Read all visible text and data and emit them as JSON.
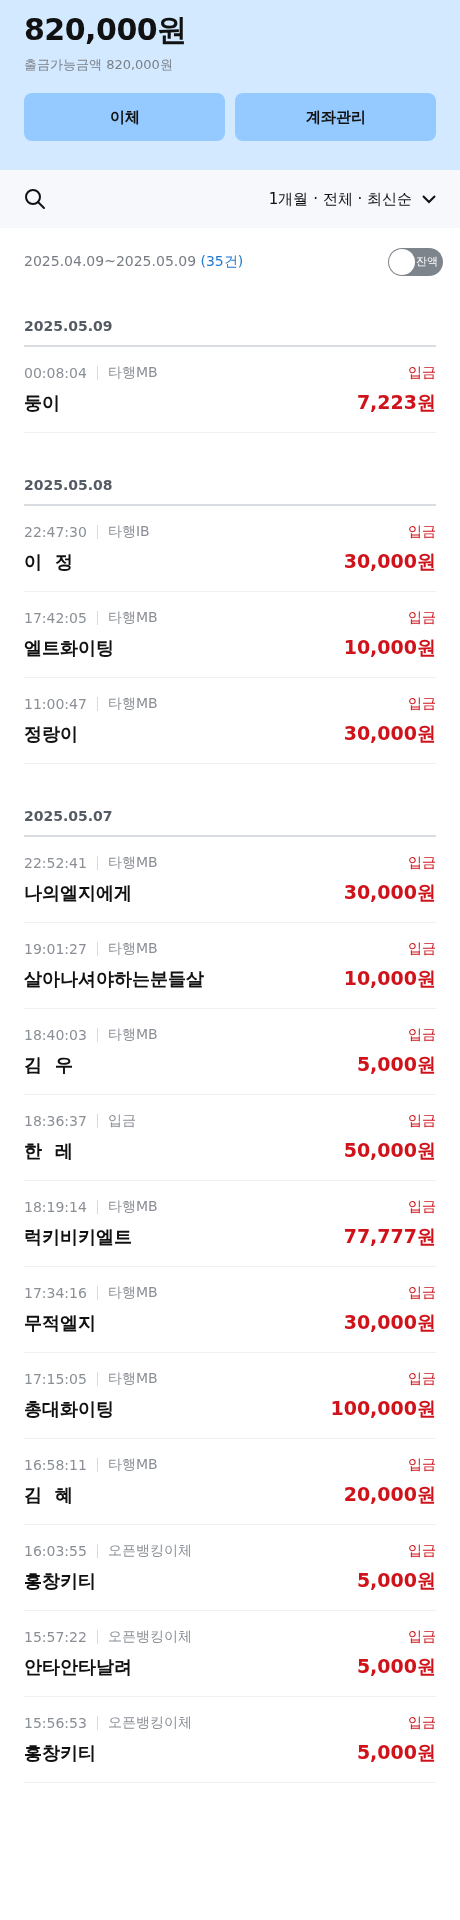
{
  "balance": {
    "amount": "820,000원",
    "available": "출금가능금액 820,000원"
  },
  "buttons": [
    "이체",
    "계좌관리"
  ],
  "filter": {
    "label": "1개월 · 전체 · 최신순"
  },
  "range": {
    "period": "2025.04.09~2025.05.09",
    "count": "(35건)"
  },
  "balance_toggle": {
    "label": "잔액",
    "on": false
  },
  "groups": [
    {
      "date": "2025.05.09",
      "transactions": [
        {
          "time": "00:08:04",
          "channel": "타행MB",
          "type": "입금",
          "kind": "deposit",
          "name": "둥이",
          "amount": "7,223원"
        }
      ]
    },
    {
      "date": "2025.05.08",
      "transactions": [
        {
          "time": "22:47:30",
          "channel": "타행IB",
          "type": "입금",
          "kind": "deposit",
          "name": "이  정",
          "amount": "30,000원"
        },
        {
          "time": "17:42:05",
          "channel": "타행MB",
          "type": "입금",
          "kind": "deposit",
          "name": "엘트화이팅",
          "amount": "10,000원"
        },
        {
          "time": "11:00:47",
          "channel": "타행MB",
          "type": "입금",
          "kind": "deposit",
          "name": "정랑이",
          "amount": "30,000원"
        }
      ]
    },
    {
      "date": "2025.05.07",
      "transactions": [
        {
          "time": "22:52:41",
          "channel": "타행MB",
          "type": "입금",
          "kind": "deposit",
          "name": "나의엘지에게",
          "amount": "30,000원"
        },
        {
          "time": "19:01:27",
          "channel": "타행MB",
          "type": "입금",
          "kind": "deposit",
          "name": "살아나셔야하는분들살",
          "amount": "10,000원"
        },
        {
          "time": "18:40:03",
          "channel": "타행MB",
          "type": "입금",
          "kind": "deposit",
          "name": "김  우",
          "amount": "5,000원"
        },
        {
          "time": "18:36:37",
          "channel": "입금",
          "type": "입금",
          "kind": "deposit",
          "name": "한  레",
          "amount": "50,000원"
        },
        {
          "time": "18:19:14",
          "channel": "타행MB",
          "type": "입금",
          "kind": "deposit",
          "name": "럭키비키엘트",
          "amount": "77,777원"
        },
        {
          "time": "17:34:16",
          "channel": "타행MB",
          "type": "입금",
          "kind": "deposit",
          "name": "무적엘지",
          "amount": "30,000원"
        },
        {
          "time": "17:15:05",
          "channel": "타행MB",
          "type": "입금",
          "kind": "deposit",
          "name": "총대화이팅",
          "amount": "100,000원"
        },
        {
          "time": "16:58:11",
          "channel": "타행MB",
          "type": "입금",
          "kind": "deposit",
          "name": "김  혜",
          "amount": "20,000원"
        },
        {
          "time": "16:03:55",
          "channel": "오픈뱅킹이체",
          "type": "입금",
          "kind": "deposit",
          "name": "홍창키티",
          "amount": "5,000원"
        },
        {
          "time": "15:57:22",
          "channel": "오픈뱅킹이체",
          "type": "입금",
          "kind": "deposit",
          "name": "안타안타날려",
          "amount": "5,000원"
        },
        {
          "time": "15:56:53",
          "channel": "오픈뱅킹이체",
          "type": "입금",
          "kind": "deposit",
          "name": "홍창키티",
          "amount": "5,000원"
        }
      ]
    }
  ]
}
